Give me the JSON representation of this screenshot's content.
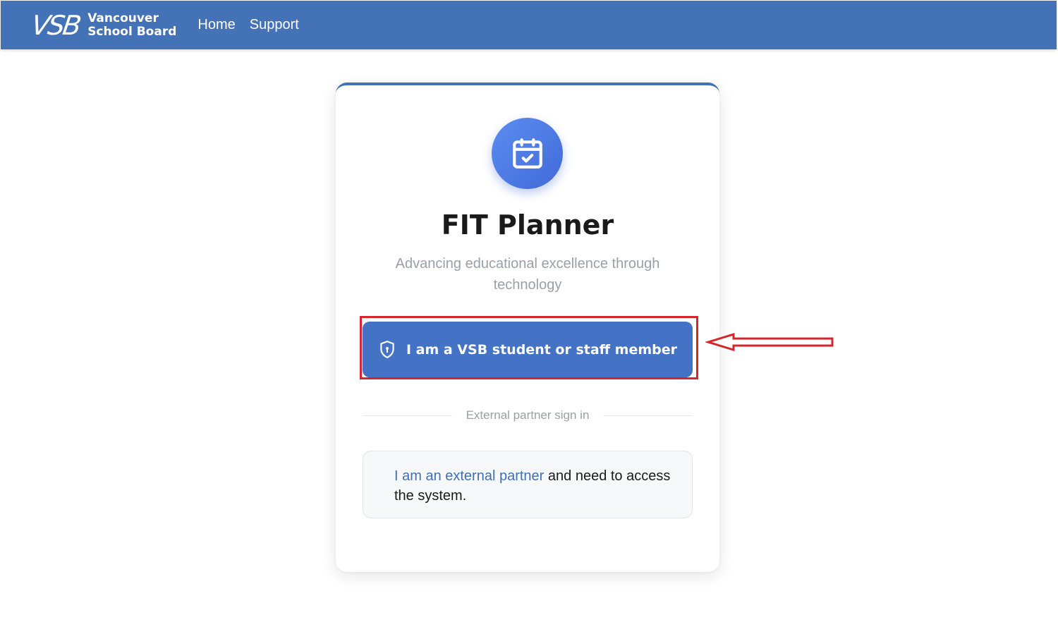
{
  "header": {
    "logo_mark": "VSB",
    "logo_line1": "Vancouver",
    "logo_line2": "School Board",
    "nav": [
      {
        "label": "Home"
      },
      {
        "label": "Support"
      }
    ]
  },
  "card": {
    "icon": "calendar-check-icon",
    "title": "FIT Planner",
    "subtitle": "Advancing educational excellence through technology",
    "primary_button": {
      "label": "I am a VSB student or staff member",
      "icon": "shield-icon"
    },
    "divider_label": "External partner sign in",
    "partner": {
      "link_text": "I am an external partner",
      "rest_text": " and need to access the system."
    }
  },
  "annotation": {
    "highlight_color": "#d6262b",
    "arrow_color": "#d6262b"
  },
  "colors": {
    "brand": "#4472b6",
    "button": "#4472c4",
    "link": "#3f6fb5"
  }
}
